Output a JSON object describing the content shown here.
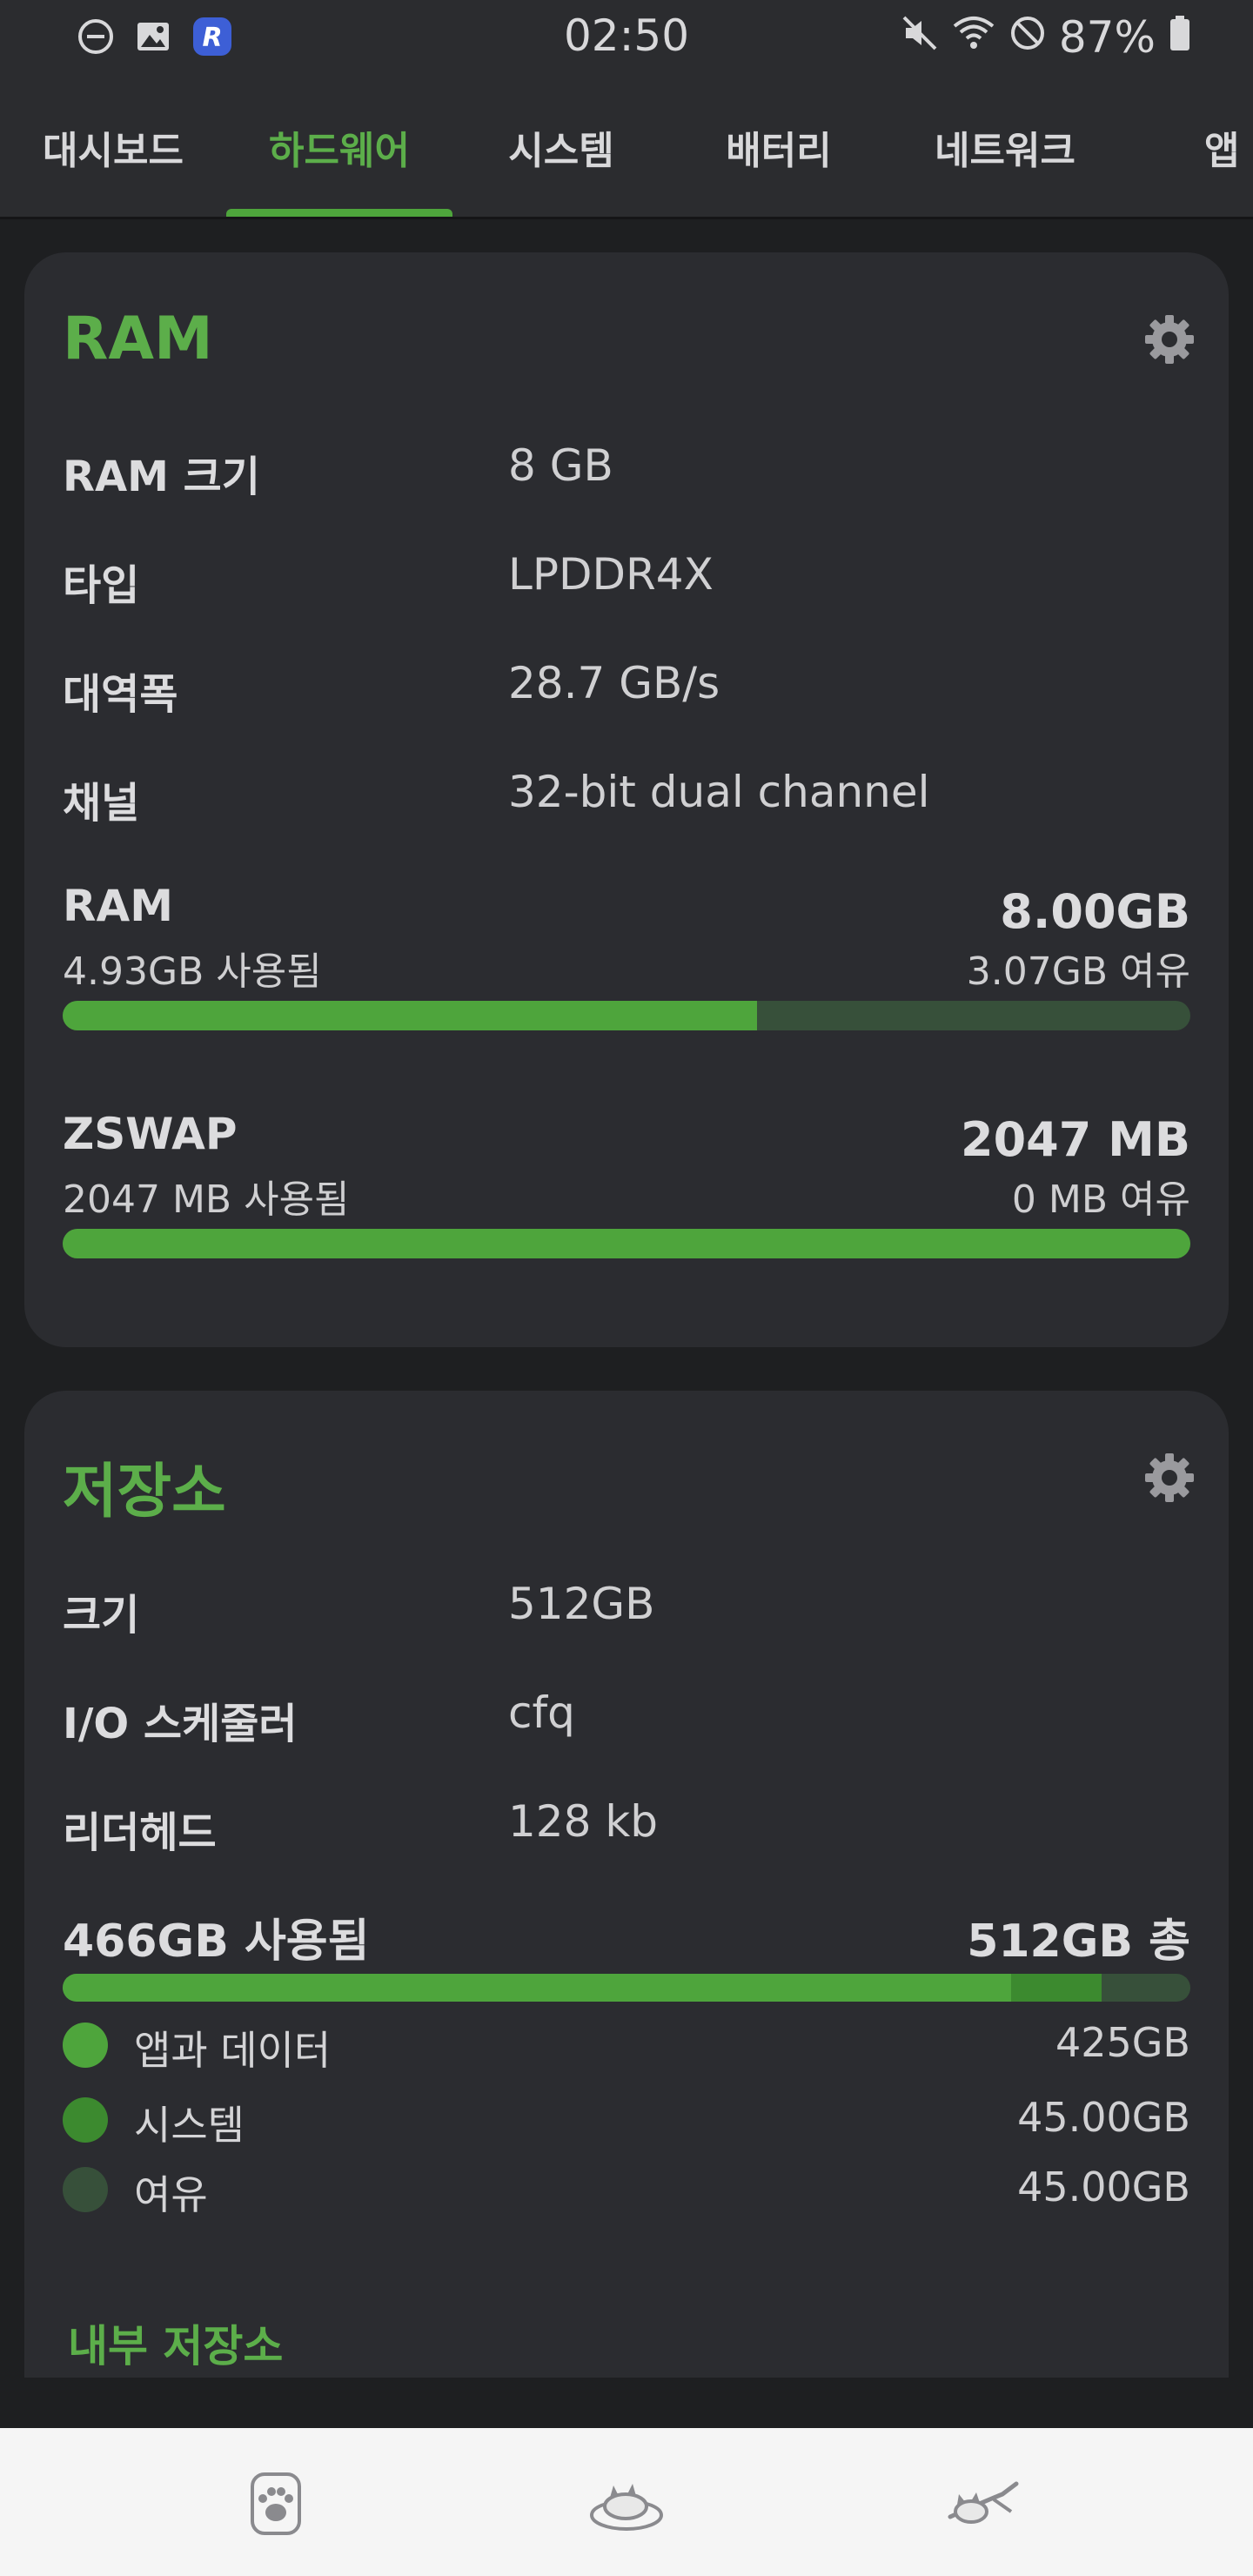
{
  "status_bar": {
    "time": "02:50",
    "battery": "87%",
    "icons": [
      "dnd-minus-icon",
      "image-icon",
      "app-r-icon",
      "mute-icon",
      "wifi-icon",
      "no-disturb-icon",
      "battery-icon"
    ]
  },
  "tabs": [
    {
      "label": "대시보드",
      "active": false
    },
    {
      "label": "하드웨어",
      "active": true
    },
    {
      "label": "시스템",
      "active": false
    },
    {
      "label": "배터리",
      "active": false
    },
    {
      "label": "네트워크",
      "active": false
    },
    {
      "label": "앱",
      "active": false
    }
  ],
  "ram_card": {
    "title": "RAM",
    "rows": [
      {
        "label": "RAM 크기",
        "value": "8 GB"
      },
      {
        "label": "타입",
        "value": "LPDDR4X"
      },
      {
        "label": "대역폭",
        "value": "28.7 GB/s"
      },
      {
        "label": "채널",
        "value": "32-bit dual channel"
      }
    ],
    "ram_meter": {
      "name": "RAM",
      "used": "4.93GB 사용됨",
      "total": "8.00GB",
      "free": "3.07GB 여유",
      "fraction_used": 0.616
    },
    "zswap_meter": {
      "name": "ZSWAP",
      "used": "2047 MB 사용됨",
      "total": "2047 MB",
      "free": "0 MB 여유",
      "fraction_used": 1.0
    }
  },
  "storage_card": {
    "title": "저장소",
    "rows": [
      {
        "label": "크기",
        "value": "512GB"
      },
      {
        "label": "I/O 스케줄러",
        "value": "cfq"
      },
      {
        "label": "리더헤드",
        "value": "128 kb"
      }
    ],
    "used_label": "466GB 사용됨",
    "total_label": "512GB 총",
    "fraction_apps": 0.841,
    "fraction_system": 0.08,
    "legend": [
      {
        "label": "앱과 데이터",
        "value": "425GB",
        "color": "#4ea53c"
      },
      {
        "label": "시스템",
        "value": "45.00GB",
        "color": "#3c8a2f"
      },
      {
        "label": "여유",
        "value": "45.00GB",
        "color": "#37503a"
      }
    ],
    "subsection": "내부 저장소"
  },
  "colors": {
    "accent": "#5cae4a",
    "bar_used": "#4ea53c",
    "bar_free": "#37503a"
  },
  "bottom_nav": [
    "paw-icon",
    "cat-bed-icon",
    "flying-cat-icon"
  ]
}
